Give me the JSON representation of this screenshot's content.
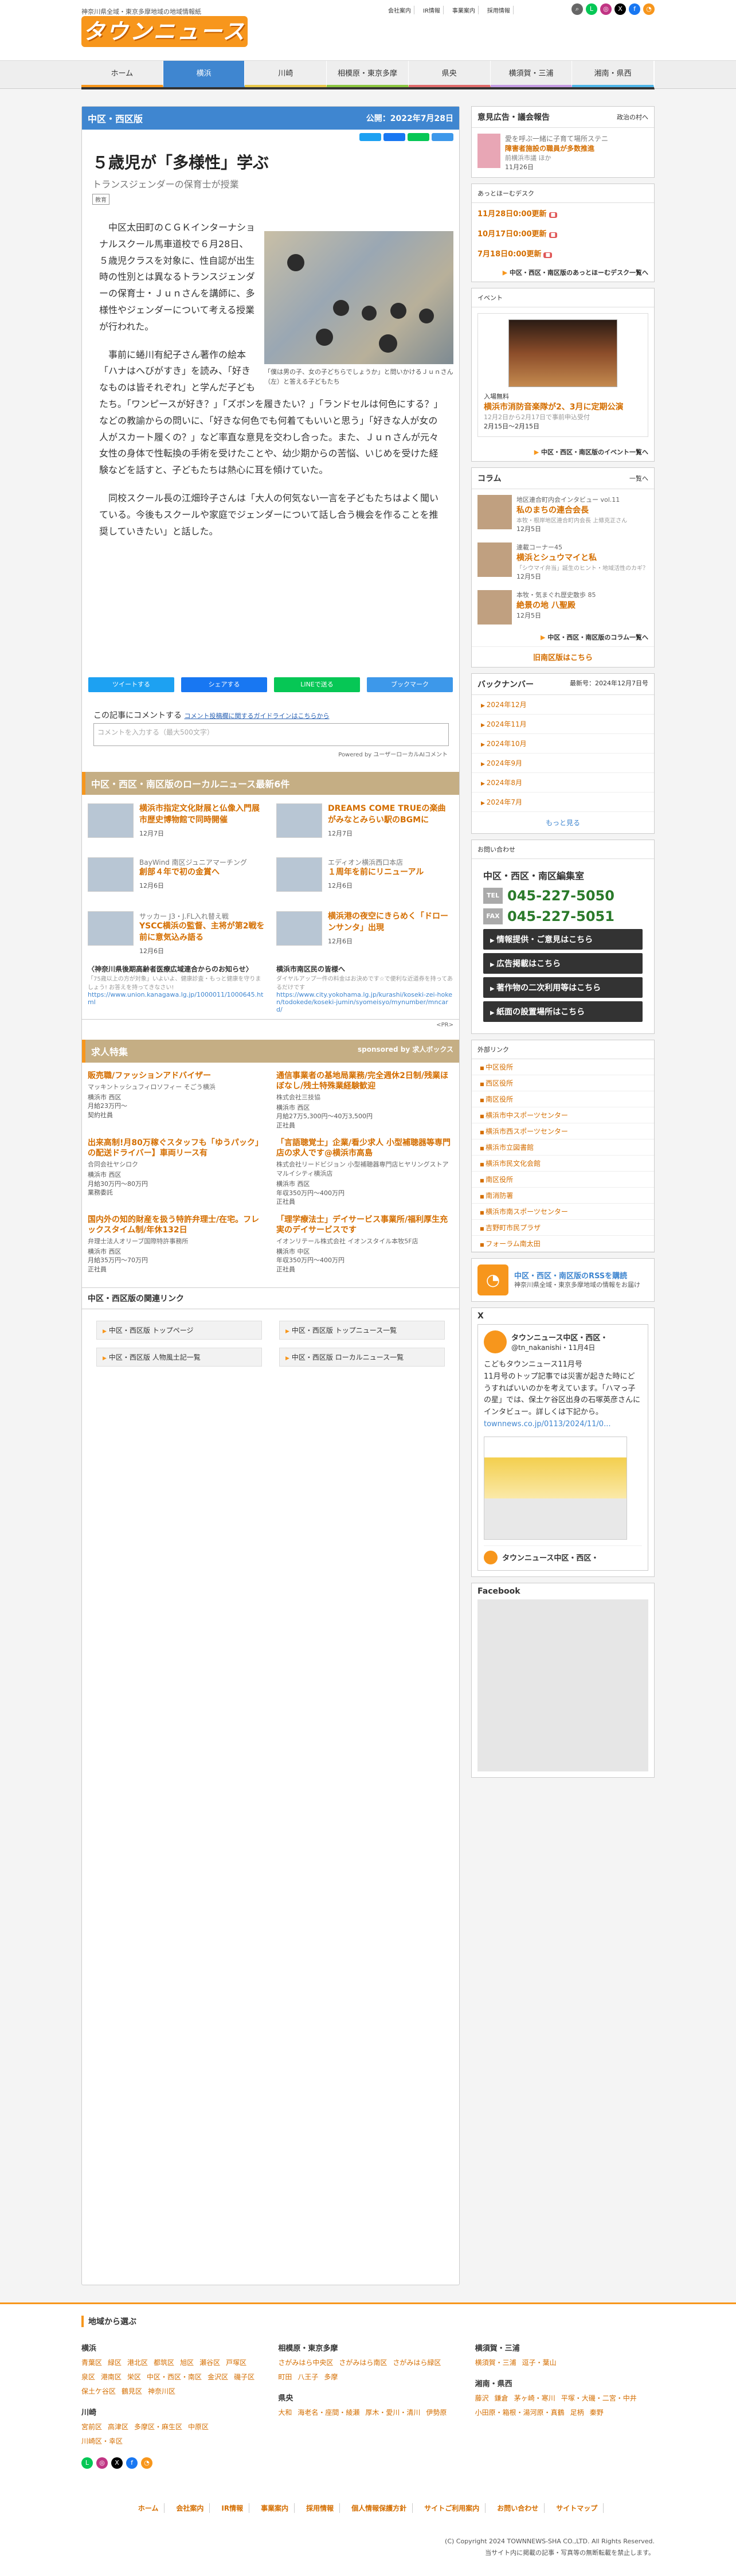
{
  "header": {
    "catch": "神奈川県全域・東京多摩地域の地域情報紙",
    "logo": "タウンニュース",
    "links": [
      "会社案内",
      "IR情報",
      "事業案内",
      "採用情報"
    ]
  },
  "nav": [
    "ホーム",
    "横浜",
    "川崎",
    "相模原・東京多摩",
    "県央",
    "横須賀・三浦",
    "湘南・県西"
  ],
  "nav_colors": [
    "#f7961c",
    "#3f86d0",
    "#e8c84a",
    "#8cc63f",
    "#e06b6b",
    "#c49be3",
    "#4fb5e8"
  ],
  "article": {
    "area": "中区・西区版",
    "date": "公開：2022年7月28日",
    "title": "５歳児が「多様性」学ぶ",
    "subtitle": "トランスジェンダーの保育士が授業",
    "tag": "教育",
    "caption": "「僕は男の子、女の子どちらでしょうか」と問いかけるＪｕｎさん（左）と答える子どもたち",
    "p1": "中区太田町のＣＧＫインターナショナルスクール馬車道校で６月28日、５歳児クラスを対象に、性自認が出生時の性別とは異なるトランスジェンダーの保育士・Ｊｕｎさんを講師に、多様性やジェンダーについて考える授業が行われた。",
    "p2": "事前に蜷川有紀子さん著作の絵本「ハナはへびがすき」を読み、「好きなものは皆それぞれ」と学んだ子どもたち。「ワンピースが好き？」「ズボンを履きたい？」「ランドセルは何色にする？」などの教諭からの問いに、「好きな何色でも何着てもいいと思う」「好きな人が女の人がスカート履くの？」など率直な意見を交わし合った。また、Ｊｕｎさんが元々女性の身体で性転換の手術を受けたことや、幼少期からの苦悩、いじめを受けた経験などを話すと、子どもたちは熱心に耳を傾けていた。",
    "p3": "同校スクール長の江畑玲子さんは「大人の何気ない一言を子どもたちはよく聞いている。今後もスクールや家庭でジェンダーについて話し合う機会を作ることを推奨していきたい」と話した。"
  },
  "share": [
    "ツイートする",
    "シェアする",
    "LINEで送る",
    "ブックマーク"
  ],
  "share_colors": [
    "#1da1f2",
    "#1877f2",
    "#06c755",
    "#3d98ea"
  ],
  "comment": {
    "label": "この記事にコメントする",
    "guide": "コメント投稿欄に関するガイドラインはこちらから",
    "placeholder": "コメントを入力する（最大500文字）",
    "powered": "Powered by ユーザーローカルAIコメント"
  },
  "local": {
    "heading": "中区・西区・南区版のローカルニュース最新6件",
    "items": [
      {
        "t1": "",
        "t2": "横浜市指定文化財展と仏像入門展 市歴史博物館で同時開催",
        "dt": "12月7日"
      },
      {
        "t1": "",
        "t2": "DREAMS COME TRUEの楽曲がみなとみらい駅のBGMに",
        "dt": "12月7日"
      },
      {
        "t1": "BayWind 南区ジュニアマーチング",
        "t2": "創部４年で初の金賞へ",
        "dt": "12月6日"
      },
      {
        "t1": "エディオン横浜西口本店",
        "t2": "１周年を前にリニューアル",
        "dt": "12月6日"
      },
      {
        "t1": "サッカー J3・J.FL入れ替え戦",
        "t2": "YSCC横浜の監督、主将が第2戦を前に意気込み語る",
        "dt": "12月6日"
      },
      {
        "t1": "",
        "t2": "横浜港の夜空にきらめく「ドローンサンタ」出現",
        "dt": "12月6日"
      }
    ]
  },
  "ads": [
    {
      "t": "〈神奈川県後期高齢者医療広域連合からのお知らせ〉",
      "g": "「75歳以上の方が対象」いよいよ、健康診査・もっと健康を守りましょう! お答えを持ってきなさい!",
      "u": "https://www.union.kanagawa.lg.jp/1000011/1000645.html"
    },
    {
      "t": "横浜市南区民の皆様へ",
      "g": "ダイヤルアップ一件の料金はお決めです☆で便利な近道券を持ってあるだけです",
      "u": "https://www.city.yokohama.lg.jp/kurashi/koseki-zei-hoken/todokede/koseki-jumin/syomeisyo/mynumber/mncard/"
    }
  ],
  "pr": "<PR>",
  "jobs": {
    "heading": "求人特集",
    "sponsor": "sponsored by 求人ボックス",
    "items": [
      {
        "t": "販売職/ファッションアドバイザー",
        "c": "マッキントッシュフィロソフィー そごう横浜",
        "d": "横浜市 西区\n月給23万円～\n契約社員"
      },
      {
        "t": "通信事業者の基地局業務/完全週休2日制/残業ほぼなし/残土特殊業経験歓迎",
        "c": "株式会社三技協",
        "d": "横浜市 西区\n月給27万5,300円～40万3,500円\n正社員"
      },
      {
        "t": "出来高制!月80万稼ぐスタッフも「ゆうパック」の配送ドライバー】車両リース有",
        "c": "合同会社ヤシロク",
        "d": "横浜市 西区\n月給30万円～80万円\n業務委託"
      },
      {
        "t": "「言語聴覚士」企業/看少求人 小型補聴器等専門店の求人です@横浜市高島",
        "c": "株式会社リードビジョン 小型補聴器専門店ヒヤリングストアマルイシティ横浜店",
        "d": "横浜市 西区\n年収350万円～400万円\n正社員"
      },
      {
        "t": "国内外の知的財産を扱う特許弁理士/在宅。フレックスタイム制/年休132日",
        "c": "弁理士法人オリーブ国際特許事務所",
        "d": "横浜市 西区\n月給35万円～70万円\n正社員"
      },
      {
        "t": "「理学療法士」デイサービス事業所/福利厚生充実のデイサービスです",
        "c": "イオンリテール株式会社 イオンスタイル本牧5F店",
        "d": "横浜市 中区\n年収350万円～400万円\n正社員"
      }
    ]
  },
  "related": {
    "heading": "中区・西区版の関連リンク",
    "items": [
      "中区・西区版 トップページ",
      "中区・西区版 トップニュース一覧",
      "中区・西区版 人物風土記一覧",
      "中区・西区版 ローカルニュース一覧"
    ]
  },
  "side": {
    "opinion": {
      "heading": "意見広告・議会報告",
      "badge": "政治の村へ",
      "o1": "愛を呼ぶ一緒に子育て場所ステニ",
      "o2": "障害者施設の職員が多数推進",
      "o3": "前横浜市議 ほか",
      "o4": "11月26日"
    },
    "atchi": {
      "heading": "あっとほーむデスク",
      "items": [
        "11月28日0:00更新",
        "10月17日0:00更新",
        "7月18日0:00更新"
      ],
      "more": "中区・西区・南区版のあっとほーむデスク一覧へ"
    },
    "event": {
      "heading": "イベント",
      "label": "入場無料",
      "title": "横浜市消防音楽隊が2、3月に定期公演",
      "note": "12月2日から2月17日で事前申込受付",
      "date": "2月15日～2月15日",
      "more": "中区・西区・南区版のイベント一覧へ"
    },
    "column": {
      "heading": "コラム",
      "more_top": "一覧へ",
      "items": [
        {
          "c1": "地区連合町内会インタビュー vol.11",
          "c2": "私のまちの連合会長",
          "c3": "本牧・根岸地区連合町内会長 上條克正さん",
          "c4": "12月5日"
        },
        {
          "c1": "連載コーナー45",
          "c2": "横浜とシュウマイと私",
          "c3": "「シウマイ弁当」誕生のヒント・地域活性のカギ？",
          "c4": "12月5日"
        },
        {
          "c1": "本牧・気まぐれ歴史散歩 85",
          "c2": "絶景の地 八聖殿",
          "c3": "",
          "c4": "12月5日"
        }
      ],
      "more": "中区・西区・南区版のコラム一覧へ",
      "old": "旧南区版はこちら"
    },
    "back": {
      "heading": "バックナンバー",
      "latest": "最新号：2024年12月7日号",
      "items": [
        "2024年12月",
        "2024年11月",
        "2024年10月",
        "2024年9月",
        "2024年8月",
        "2024年7月"
      ],
      "more": "もっと見る"
    },
    "inq": {
      "heading": "お問い合わせ",
      "office": "中区・西区・南区編集室",
      "tel_label": "TEL",
      "tel": "045-227-5050",
      "fax_label": "FAX",
      "fax": "045-227-5051",
      "buttons": [
        "情報提供・ご意見はこちら",
        "広告掲載はこちら",
        "著作物の二次利用等はこちら",
        "紙面の設置場所はこちら"
      ]
    },
    "ext": {
      "heading": "外部リンク",
      "items": [
        "中区役所",
        "西区役所",
        "南区役所",
        "横浜市中スポーツセンター",
        "横浜市西スポーツセンター",
        "横浜市立図書館",
        "横浜市民文化会館",
        "南区役所",
        "南消防署",
        "横浜市南スポーツセンター",
        "吉野町市民プラザ",
        "フォーラム南太田"
      ]
    },
    "rss": {
      "r1": "中区・西区・南区版のRSSを購読",
      "r2": "神奈川県全域・東京多摩地域の情報をお届け"
    },
    "x": {
      "heading": "X",
      "name": "タウンニュース中区・西区・",
      "handle": "@tn_nakanishi・11月4日",
      "text": "こどもタウンニュース11月号",
      "body": "11月号のトップ記事では災害が起きた時にどうすればいいのかを考えています。「ハマっ子の星」では、保土ケ谷区出身の石塚英彦さんにインタビュー。詳しくは下記から。",
      "link": "townnews.co.jp/0113/2024/11/0...",
      "footer": "タウンニュース中区・西区・"
    },
    "fb": {
      "heading": "Facebook"
    }
  },
  "footer": {
    "heading": "地域から選ぶ",
    "cols": [
      [
        {
          "h": "横浜",
          "items": [
            "青葉区",
            "緑区",
            "港北区",
            "都筑区",
            "旭区",
            "瀬谷区",
            "戸塚区",
            "泉区",
            "港南区",
            "栄区",
            "中区・西区・南区",
            "金沢区",
            "磯子区",
            "保土ケ谷区",
            "鶴見区",
            "神奈川区"
          ]
        },
        {
          "h": "川崎",
          "items": [
            "宮前区",
            "高津区",
            "多摩区・麻生区",
            "中原区",
            "川崎区・幸区"
          ]
        }
      ],
      [
        {
          "h": "相模原・東京多摩",
          "items": [
            "さがみはら中央区",
            "さがみはら南区",
            "さがみはら緑区",
            "町田",
            "八王子",
            "多摩"
          ]
        },
        {
          "h": "県央",
          "items": [
            "大和",
            "海老名・座間・綾瀬",
            "厚木・愛川・清川",
            "伊勢原"
          ]
        }
      ],
      [
        {
          "h": "横須賀・三浦",
          "items": [
            "横須賀・三浦",
            "逗子・葉山"
          ]
        },
        {
          "h": "湘南・県西",
          "items": [
            "藤沢",
            "鎌倉",
            "茅ヶ崎・寒川",
            "平塚・大磯・二宮・中井",
            "小田原・箱根・湯河原・真鶴",
            "足柄",
            "秦野"
          ]
        }
      ]
    ],
    "nav": [
      "ホーム",
      "会社案内",
      "IR情報",
      "事業案内",
      "採用情報",
      "個人情報保護方針",
      "サイトご利用案内",
      "お問い合わせ",
      "サイトマップ"
    ],
    "copy": "(C) Copyright 2024 TOWNNEWS-SHA CO.,LTD. All Rights Reserved.",
    "note": "当サイト内に掲載の記事・写真等の無断転載を禁止します。"
  },
  "icons": [
    "search-icon",
    "line-icon",
    "instagram-icon",
    "x-icon",
    "facebook-icon",
    "rss-icon"
  ]
}
